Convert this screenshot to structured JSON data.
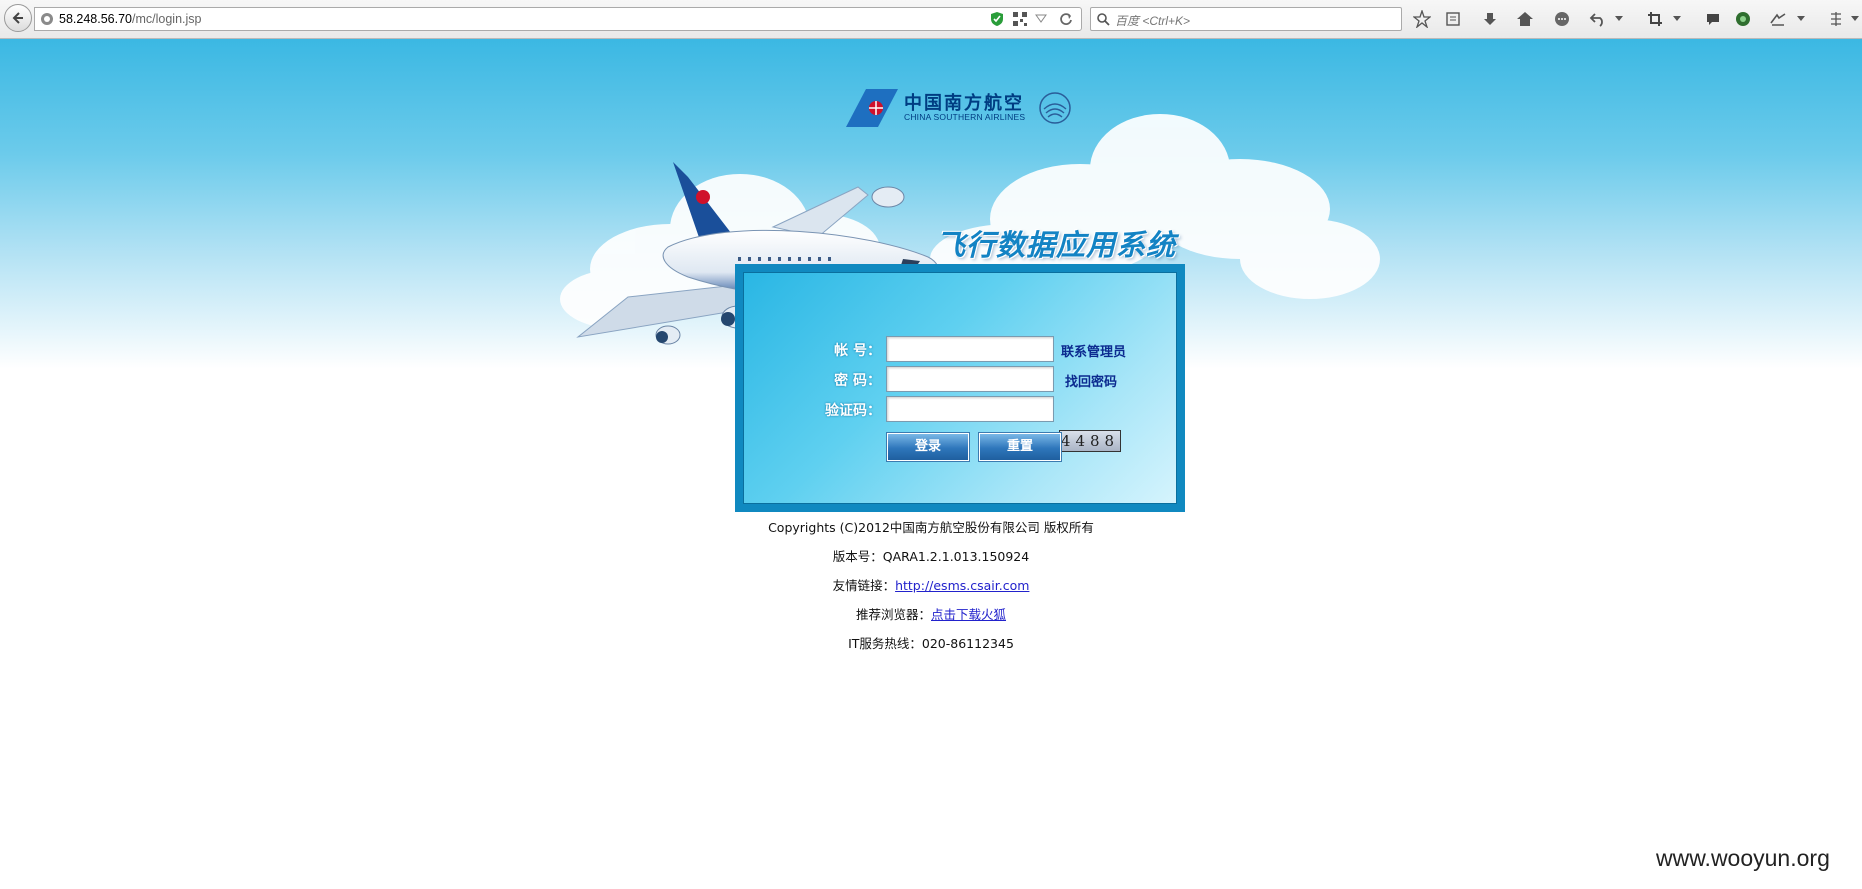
{
  "browser": {
    "url_host": "58.248.56.70",
    "url_path": "/mc/login.jsp",
    "search_placeholder": "百度 <Ctrl+K>"
  },
  "logo": {
    "cn": "中国南方航空",
    "en": "CHINA SOUTHERN AIRLINES"
  },
  "system_title": "飞行数据应用系统",
  "form": {
    "account_label": "帐  号：",
    "password_label": "密  码：",
    "captcha_label": "验证码：",
    "contact_admin_link": "联系管理员",
    "recover_password_link": "找回密码",
    "captcha_value": "4488",
    "login_button": "登录",
    "reset_button": "重置",
    "account_value": "",
    "password_value": "",
    "captcha_input_value": ""
  },
  "footer": {
    "copyright": "Copyrights (C)2012中国南方航空股份有限公司 版权所有",
    "version": "版本号：QARA1.2.1.013.150924",
    "friend_link_label": "友情链接：",
    "friend_link_url": "http://esms.csair.com",
    "browser_label": "推荐浏览器：",
    "browser_link": "点击下载火狐",
    "hotline": "IT服务热线：020-86112345"
  },
  "watermark": "www.wooyun.org"
}
